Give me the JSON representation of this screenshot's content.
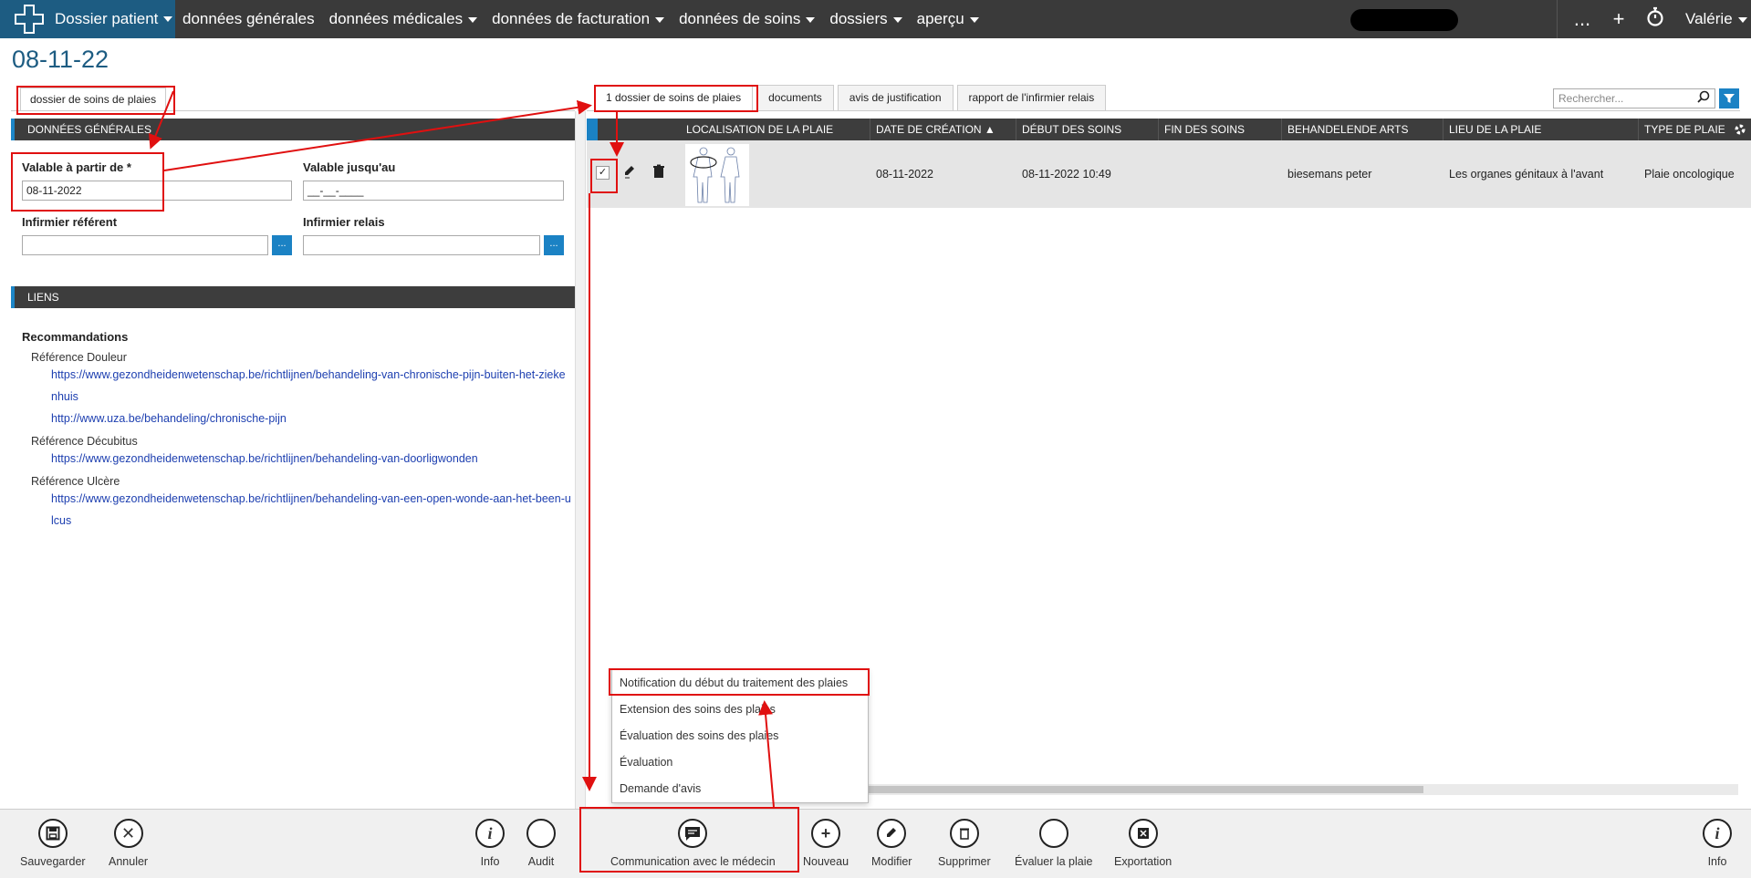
{
  "nav": {
    "brand": "Dossier patient",
    "menu": [
      "données générales",
      "données médicales",
      "données de facturation",
      "données de soins",
      "dossiers",
      "aperçu"
    ],
    "more": "...",
    "user": "Valérie"
  },
  "page_title": "08-11-22",
  "left_tab": "dossier de soins de plaies",
  "general": {
    "header": "DONNÉES GÉNÉRALES",
    "valid_from_label": "Valable à partir de *",
    "valid_from_value": "08-11-2022",
    "valid_until_label": "Valable jusqu'au",
    "valid_until_value": "__-__-____",
    "ref_nurse_label": "Infirmier référent",
    "relay_nurse_label": "Infirmier relais",
    "dots": "..."
  },
  "links": {
    "header": "LIENS",
    "group": "Recommandations",
    "refs": [
      {
        "label": "Référence Douleur",
        "urls": [
          "https://www.gezondheidenwetenschap.be/richtlijnen/behandeling-van-chronische-pijn-buiten-het-ziekenhuis",
          "http://www.uza.be/behandeling/chronische-pijn"
        ]
      },
      {
        "label": "Référence Décubitus",
        "urls": [
          "https://www.gezondheidenwetenschap.be/richtlijnen/behandeling-van-doorligwonden"
        ]
      },
      {
        "label": "Référence Ulcère",
        "urls": [
          "https://www.gezondheidenwetenschap.be/richtlijnen/behandeling-van-een-open-wonde-aan-het-been-ulcus"
        ]
      }
    ]
  },
  "right_tabs": [
    "1 dossier de soins de plaies",
    "documents",
    "avis de justification",
    "rapport de l'infirmier relais"
  ],
  "search_placeholder": "Rechercher...",
  "grid": {
    "columns": [
      "LOCALISATION DE LA PLAIE",
      "DATE DE CRÉATION",
      "DÉBUT DES SOINS",
      "FIN DES SOINS",
      "BEHANDELENDE ARTS",
      "LIEU DE LA PLAIE",
      "TYPE DE PLAIE"
    ],
    "row": {
      "created": "08-11-2022",
      "start": "08-11-2022 10:49",
      "end": "",
      "doctor": "biesemans peter",
      "location": "Les organes génitaux à l'avant",
      "type": "Plaie oncologique"
    }
  },
  "dropdown": [
    "Notification du début du traitement des plaies",
    "Extension des soins des plaies",
    "Évaluation des soins des plaies",
    "Évaluation",
    "Demande d'avis"
  ],
  "toolbar": {
    "save": "Sauvegarder",
    "cancel": "Annuler",
    "info": "Info",
    "audit": "Audit",
    "comm": "Communication avec le médecin",
    "new": "Nouveau",
    "edit": "Modifier",
    "delete": "Supprimer",
    "evaluate": "Évaluer la plaie",
    "export": "Exportation",
    "info_right": "Info"
  },
  "colors": {
    "nav_bg": "#3a3a3a",
    "brand_bg": "#1d5c82",
    "accent": "#1b82c4",
    "annotation": "#e01010"
  }
}
